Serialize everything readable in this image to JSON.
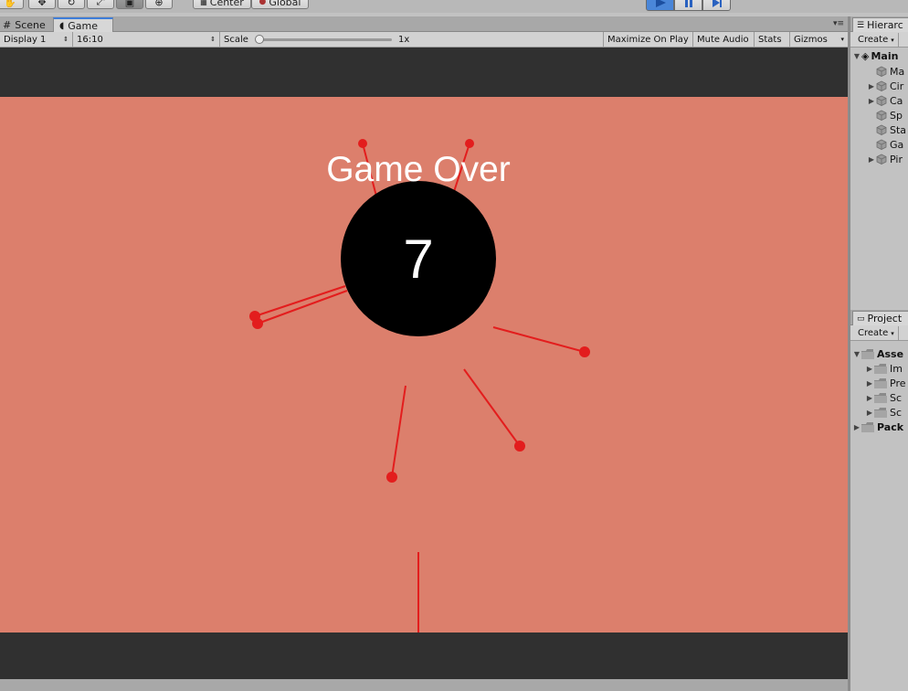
{
  "toolbar": {
    "pivot_label": "Center",
    "space_label": "Global"
  },
  "tabs": {
    "scene_label": "Scene",
    "game_label": "Game"
  },
  "gamebar": {
    "display": "Display 1",
    "aspect": "16:10",
    "scale_label": "Scale",
    "scale_value": "1x",
    "maximize": "Maximize On Play",
    "mute": "Mute Audio",
    "stats": "Stats",
    "gizmos": "Gizmos"
  },
  "game": {
    "message": "Game Over",
    "score": "7",
    "background_color": "#dc7f6c",
    "pin_color": "#e31d1d"
  },
  "hierarchy": {
    "tab_label": "Hierarc",
    "create_label": "Create",
    "scene_name": "Main",
    "items": [
      {
        "label": "Ma",
        "expandable": false
      },
      {
        "label": "Cir",
        "expandable": true
      },
      {
        "label": "Ca",
        "expandable": true
      },
      {
        "label": "Sp",
        "expandable": false
      },
      {
        "label": "Sta",
        "expandable": false
      },
      {
        "label": "Ga",
        "expandable": false
      },
      {
        "label": "Pir",
        "expandable": true
      }
    ]
  },
  "project": {
    "tab_label": "Project",
    "create_label": "Create",
    "assets_label": "Asse",
    "asset_folders": [
      "Im",
      "Pre",
      "Sc",
      "Sc"
    ],
    "packages_label": "Pack"
  }
}
